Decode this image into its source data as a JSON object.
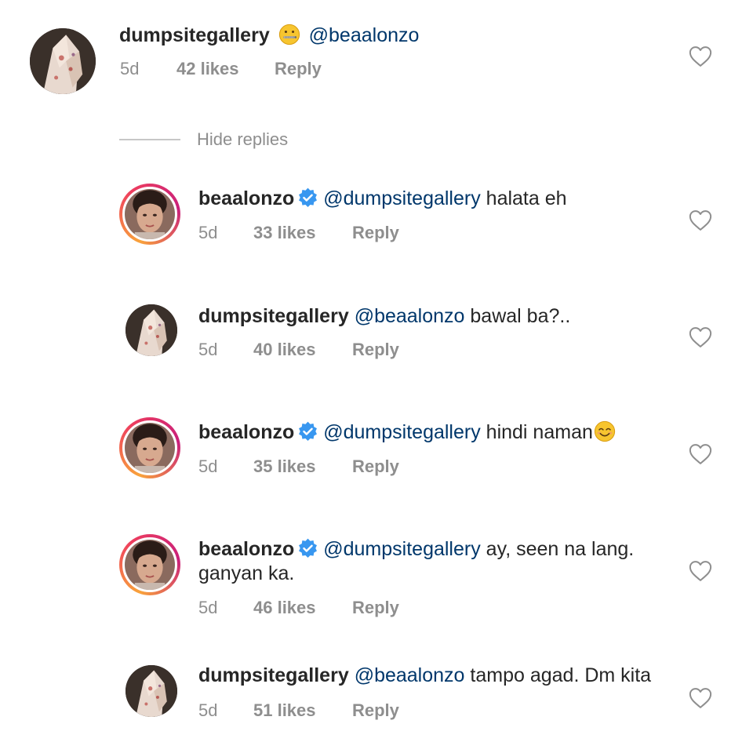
{
  "comment": {
    "username": "dumpsitegallery",
    "emoji": "zipper-mouth-face",
    "mention": "@beaalonzo",
    "text": "",
    "time": "5d",
    "likes": "42 likes",
    "reply": "Reply"
  },
  "hide_replies": "Hide replies",
  "replies": [
    {
      "username": "beaalonzo",
      "mention": "@dumpsitegallery",
      "text": " halata eh",
      "time": "5d",
      "likes": "33 likes",
      "reply": "Reply"
    },
    {
      "username": "dumpsitegallery",
      "mention": "@beaalonzo",
      "text": " bawal ba?..",
      "time": "5d",
      "likes": "40 likes",
      "reply": "Reply"
    },
    {
      "username": "beaalonzo",
      "mention": "@dumpsitegallery",
      "text": " hindi naman",
      "emoji": "smiling-face",
      "time": "5d",
      "likes": "35 likes",
      "reply": "Reply"
    },
    {
      "username": "beaalonzo",
      "mention": "@dumpsitegallery",
      "text": " ay, seen na lang. ganyan ka.",
      "time": "5d",
      "likes": "46 likes",
      "reply": "Reply"
    },
    {
      "username": "dumpsitegallery",
      "mention": "@beaalonzo",
      "text": " tampo agad. Dm kita",
      "time": "5d",
      "likes": "51 likes",
      "reply": "Reply"
    }
  ],
  "colors": {
    "text": "#262626",
    "mention": "#00376b",
    "meta": "#8e8e8e",
    "verified": "#3897f0"
  }
}
